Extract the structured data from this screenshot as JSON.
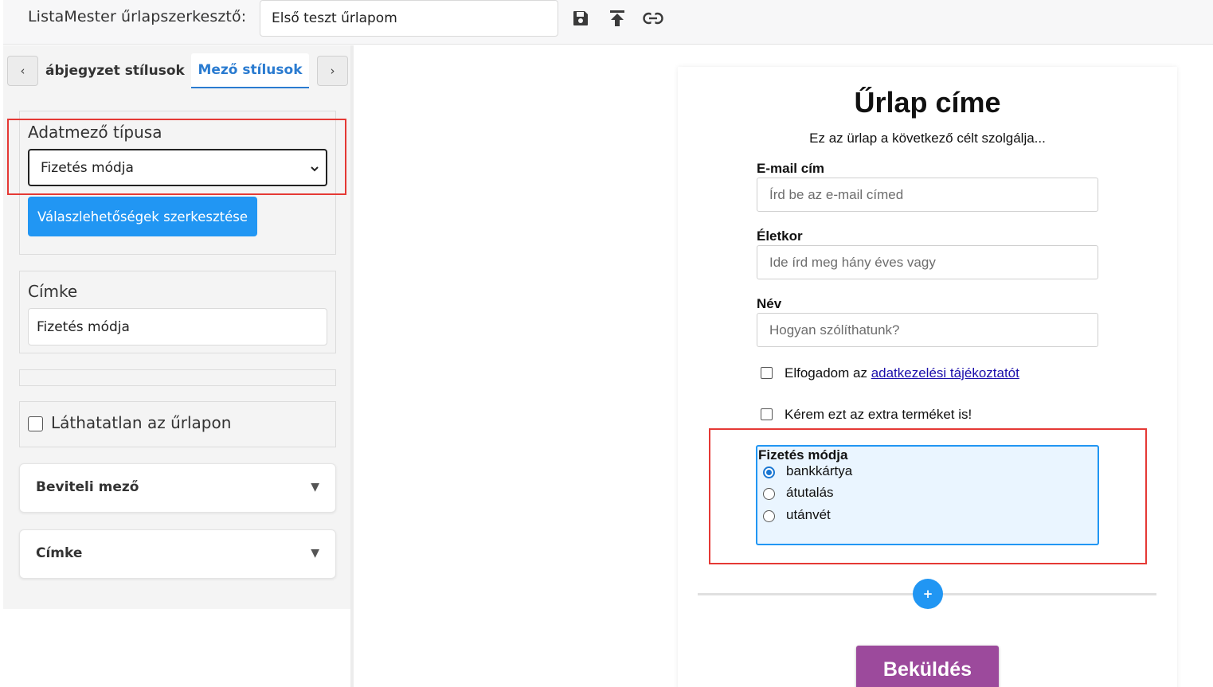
{
  "header": {
    "app_title": "ListaMester űrlapszerkesztő:",
    "form_name_value": "Első teszt űrlapom",
    "icons": [
      "save-icon",
      "upload-icon",
      "link-icon"
    ]
  },
  "left_panel": {
    "tabs": {
      "prev_label": "‹",
      "inactive_label": "ábjegyzet stílusok",
      "active_label": "Mező stílusok",
      "next_label": "›"
    },
    "field_type": {
      "label": "Adatmező típusa",
      "selected": "Fizetés módja",
      "edit_options_button": "Válaszlehetőségek szerkesztése"
    },
    "label_section": {
      "label": "Címke",
      "value": "Fizetés módja"
    },
    "hidden_checkbox": {
      "label": "Láthatatlan az űrlapon",
      "checked": false
    },
    "accordions": [
      {
        "label": "Beviteli mező",
        "arrow": "▼"
      },
      {
        "label": "Címke",
        "arrow": "▼"
      }
    ]
  },
  "form": {
    "title": "Űrlap címe",
    "subtitle": "Ez az ürlap a következő célt szolgálja...",
    "fields": [
      {
        "label": "E-mail cím",
        "placeholder": "Írd be az e-mail címed"
      },
      {
        "label": "Életkor",
        "placeholder": "Ide írd meg hány éves vagy"
      },
      {
        "label": "Név",
        "placeholder": "Hogyan szólíthatunk?"
      }
    ],
    "consent": {
      "text": "Elfogadom az ",
      "link": "adatkezelési tájékoztatót"
    },
    "extra_product": "Kérem ezt az extra terméket is!",
    "payment": {
      "title": "Fizetés módja",
      "options": [
        "bankkártya",
        "átutalás",
        "utánvét"
      ],
      "selected": "bankkártya"
    },
    "add_label": "+",
    "submit_label": "Beküldés"
  },
  "colors": {
    "accent": "#2196f3",
    "active_tab": "#2a7bd0",
    "submit": "#9c4a9c",
    "highlight_frame": "#e53935",
    "payment_bg": "#eaf5ff"
  }
}
